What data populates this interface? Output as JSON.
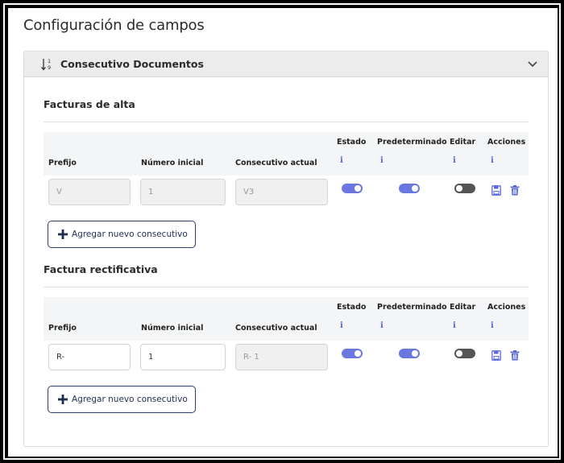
{
  "page": {
    "title": "Configuración de campos"
  },
  "accordion": {
    "title": "Consecutivo Documentos"
  },
  "sections": [
    {
      "title": "Facturas de alta",
      "columns": [
        "Prefijo",
        "Número inicial",
        "Consecutivo actual",
        "Estado",
        "Predeterminado",
        "Editar",
        "Acciones"
      ],
      "info_glyph": "i",
      "row": {
        "prefijo": "V",
        "numero_inicial": "1",
        "consecutivo_actual": "V3",
        "prefijo_editable": false,
        "numero_editable": false,
        "estado": true,
        "predeterminado": true,
        "editar": false
      },
      "add_label": "Agregar nuevo consecutivo"
    },
    {
      "title": "Factura rectificativa",
      "columns": [
        "Prefijo",
        "Número inicial",
        "Consecutivo actual",
        "Estado",
        "Predeterminado",
        "Editar",
        "Acciones"
      ],
      "info_glyph": "i",
      "row": {
        "prefijo": "R-",
        "numero_inicial": "1",
        "consecutivo_actual": "R- 1",
        "prefijo_editable": true,
        "numero_editable": true,
        "estado": true,
        "predeterminado": true,
        "editar": false
      },
      "add_label": "Agregar nuevo consecutivo"
    }
  ],
  "icons": {
    "sort": "sort-numeric-icon",
    "chevron": "chevron-down-icon",
    "save": "save-icon",
    "delete": "trash-icon",
    "add": "plus-icon",
    "info": "info-icon"
  },
  "colors": {
    "accent": "#6b77e0",
    "button_border": "#2c3e6b",
    "toggle_off": "#555555"
  }
}
